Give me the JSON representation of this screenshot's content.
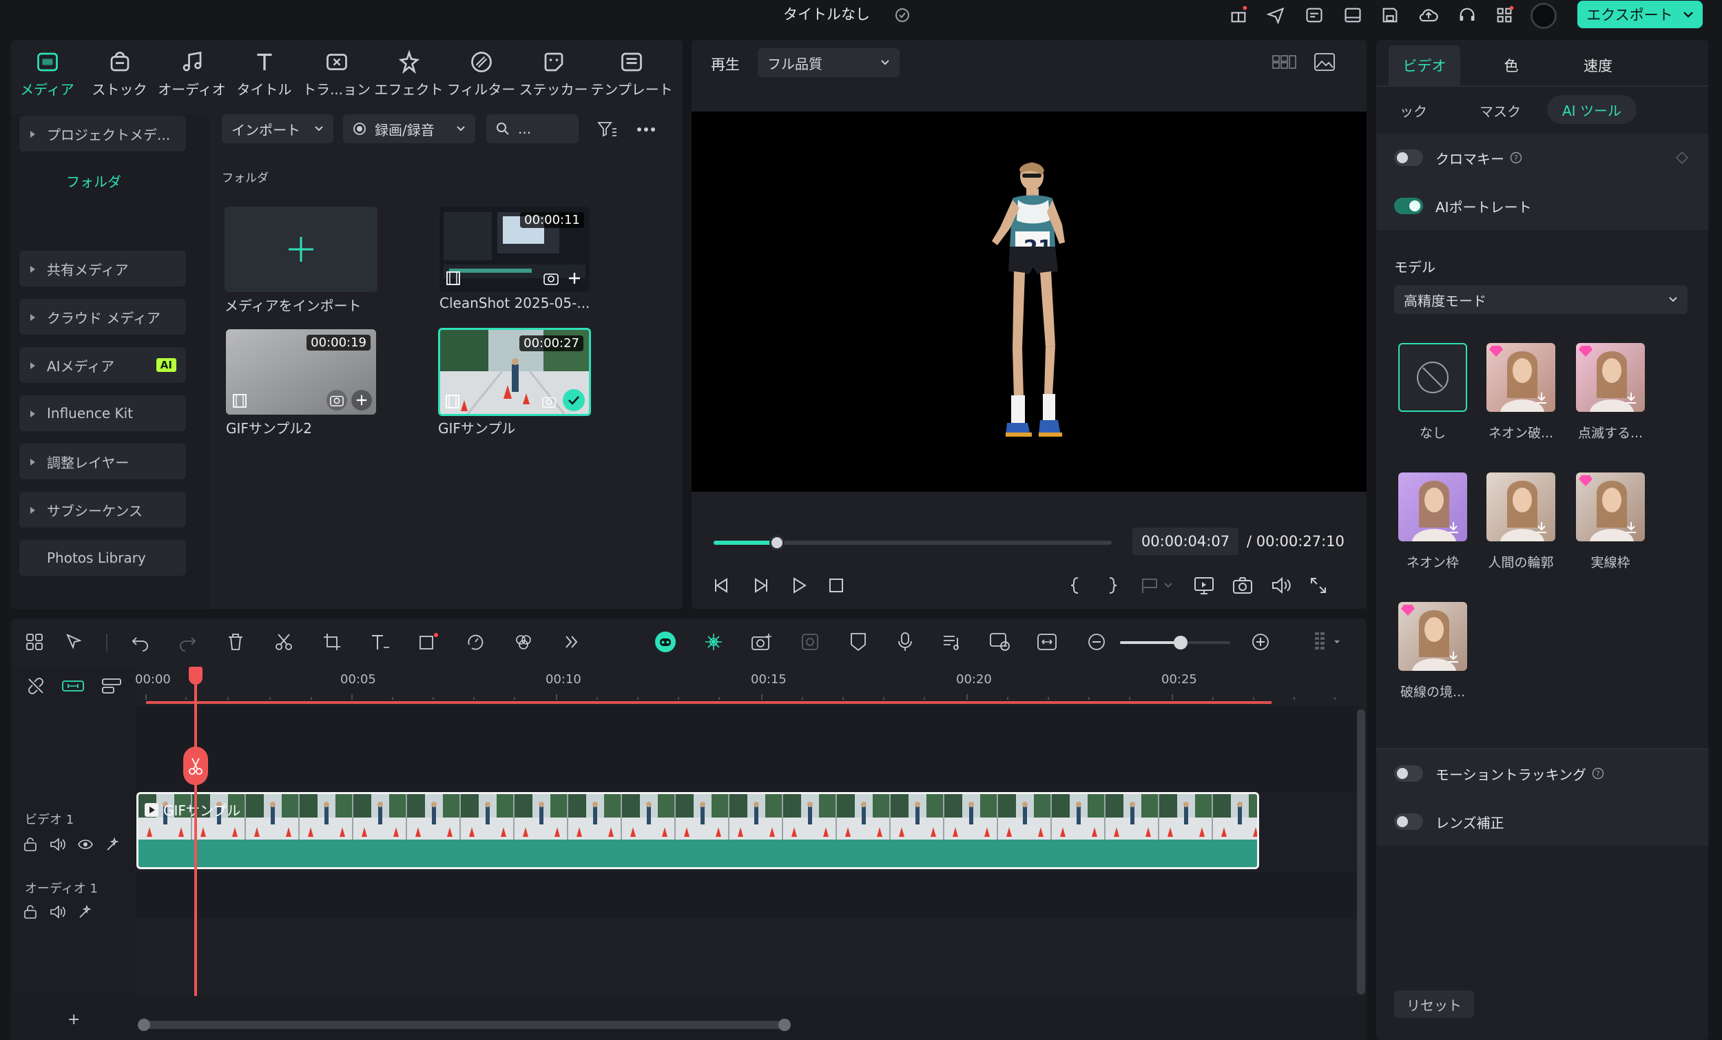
{
  "app": {
    "title": "タイトルなし",
    "export_label": "エクスポート",
    "accent": "#2ee0b8"
  },
  "media_tabs": [
    {
      "label": "メディア",
      "icon": "media-icon"
    },
    {
      "label": "ストック",
      "icon": "stock-icon"
    },
    {
      "label": "オーディオ",
      "icon": "audio-icon"
    },
    {
      "label": "タイトル",
      "icon": "title-icon"
    },
    {
      "label": "トラ...ョン",
      "icon": "transition-icon"
    },
    {
      "label": "エフェクト",
      "icon": "effect-icon"
    },
    {
      "label": "フィルター",
      "icon": "filter-icon"
    },
    {
      "label": "ステッカー",
      "icon": "sticker-icon"
    },
    {
      "label": "テンプレート",
      "icon": "template-icon"
    }
  ],
  "sidebar": {
    "project_media": "プロジェクトメデ...",
    "folder": "フォルダ",
    "items": [
      "共有メディア",
      "クラウド メディア",
      "AIメディア",
      "Influence Kit",
      "調整レイヤー",
      "サブシーケンス",
      "Photos Library"
    ],
    "ai_badge": "AI"
  },
  "media_toolbar": {
    "import": "インポート",
    "record": "録画/録音",
    "search_placeholder": "..."
  },
  "media_grid": {
    "folder_heading": "フォルダ",
    "items": [
      {
        "label": "メディアをインポート"
      },
      {
        "label": "CleanShot 2025-05-...",
        "duration": "00:00:11"
      },
      {
        "label": "GIFサンプル2",
        "duration": "00:00:19"
      },
      {
        "label": "GIFサンプル",
        "duration": "00:00:27"
      }
    ]
  },
  "preview": {
    "play_label": "再生",
    "quality": "フル品質",
    "current_time": "00:00:04:07",
    "total_time": "/ 00:00:27:10",
    "progress": 0.16,
    "bib_number": "21"
  },
  "props": {
    "tabs": [
      "ビデオ",
      "色",
      "速度"
    ],
    "subtabs": [
      "ック",
      "マスク",
      "AI ツール"
    ],
    "chroma_key": "クロマキー",
    "ai_portrait": "AIポートレート",
    "model_label": "モデル",
    "model_value": "高精度モード",
    "effects": [
      "なし",
      "ネオン破...",
      "点滅する...",
      "ネオン枠",
      "人間の輪郭",
      "実線枠",
      "破線の境..."
    ],
    "motion_tracking": "モーショントラッキング",
    "lens_correction": "レンズ補正",
    "reset": "リセット"
  },
  "timeline": {
    "ruler": [
      "00:00",
      "00:05",
      "00:10",
      "00:15",
      "00:20",
      "00:25"
    ],
    "video_track": "ビデオ 1",
    "audio_track": "オーディオ 1",
    "clip_title": "GIFサンプル",
    "zoom_level": 0.55,
    "add_track": "+"
  }
}
